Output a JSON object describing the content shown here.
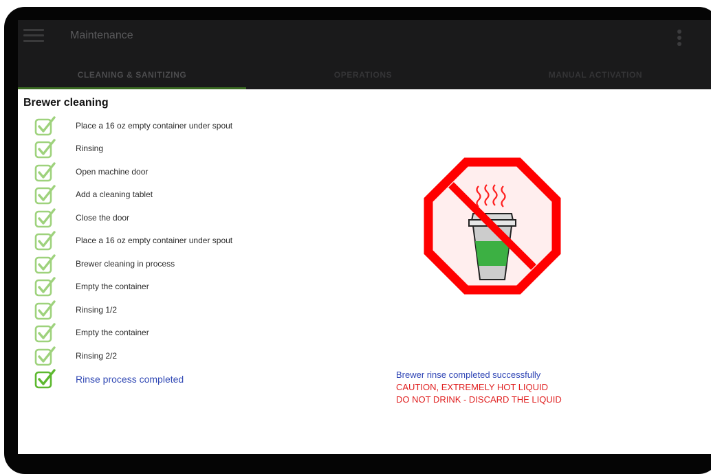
{
  "app": {
    "title": "Maintenance"
  },
  "tabs": [
    {
      "label": "CLEANING & SANITIZING",
      "active": true
    },
    {
      "label": "OPERATIONS",
      "active": false
    },
    {
      "label": "MANUAL ACTIVATION",
      "active": false
    }
  ],
  "section": {
    "title": "Brewer cleaning"
  },
  "steps": [
    {
      "label": "Place a 16 oz empty container under spout",
      "done": true
    },
    {
      "label": "Rinsing",
      "done": true
    },
    {
      "label": "Open machine door",
      "done": true
    },
    {
      "label": "Add a cleaning tablet",
      "done": true
    },
    {
      "label": "Close the door",
      "done": true
    },
    {
      "label": "Place a 16 oz empty container under spout",
      "done": true
    },
    {
      "label": "Brewer cleaning in process",
      "done": true
    },
    {
      "label": "Empty the container",
      "done": true
    },
    {
      "label": "Rinsing 1/2",
      "done": true
    },
    {
      "label": "Empty the container",
      "done": true
    },
    {
      "label": "Rinsing 2/2",
      "done": true
    },
    {
      "label": "Rinse process completed",
      "done": true,
      "current": true
    }
  ],
  "status": {
    "success": "Brewer rinse completed successfully",
    "caution": "CAUTION, EXTREMELY HOT LIQUID",
    "warning": "DO NOT DRINK - DISCARD THE LIQUID"
  },
  "icons": {
    "menu": "hamburger-menu-icon",
    "overflow": "more-vert-icon",
    "check": "checkbox-checked-icon",
    "sign": "no-drinking-sign-icon"
  },
  "colors": {
    "app_bar": "#1a1a1b",
    "tab_indicator": "#3a6a22",
    "check_done": "#9ed27c",
    "check_current": "#5cb82e",
    "success_text": "#2f45b5",
    "warning_text": "#e02020",
    "sign_red": "#ff0000",
    "liquid_green": "#3cb043"
  }
}
